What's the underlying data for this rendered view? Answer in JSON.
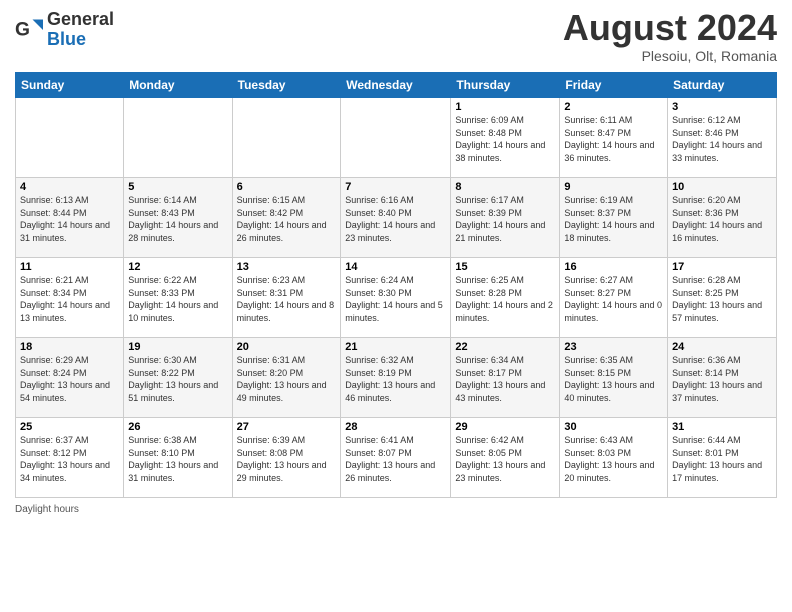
{
  "header": {
    "logo_general": "General",
    "logo_blue": "Blue",
    "month_year": "August 2024",
    "location": "Plesoiu, Olt, Romania"
  },
  "days_of_week": [
    "Sunday",
    "Monday",
    "Tuesday",
    "Wednesday",
    "Thursday",
    "Friday",
    "Saturday"
  ],
  "weeks": [
    [
      {
        "day": "",
        "sunrise": "",
        "sunset": "",
        "daylight": ""
      },
      {
        "day": "",
        "sunrise": "",
        "sunset": "",
        "daylight": ""
      },
      {
        "day": "",
        "sunrise": "",
        "sunset": "",
        "daylight": ""
      },
      {
        "day": "",
        "sunrise": "",
        "sunset": "",
        "daylight": ""
      },
      {
        "day": "1",
        "sunrise": "Sunrise: 6:09 AM",
        "sunset": "Sunset: 8:48 PM",
        "daylight": "Daylight: 14 hours and 38 minutes."
      },
      {
        "day": "2",
        "sunrise": "Sunrise: 6:11 AM",
        "sunset": "Sunset: 8:47 PM",
        "daylight": "Daylight: 14 hours and 36 minutes."
      },
      {
        "day": "3",
        "sunrise": "Sunrise: 6:12 AM",
        "sunset": "Sunset: 8:46 PM",
        "daylight": "Daylight: 14 hours and 33 minutes."
      }
    ],
    [
      {
        "day": "4",
        "sunrise": "Sunrise: 6:13 AM",
        "sunset": "Sunset: 8:44 PM",
        "daylight": "Daylight: 14 hours and 31 minutes."
      },
      {
        "day": "5",
        "sunrise": "Sunrise: 6:14 AM",
        "sunset": "Sunset: 8:43 PM",
        "daylight": "Daylight: 14 hours and 28 minutes."
      },
      {
        "day": "6",
        "sunrise": "Sunrise: 6:15 AM",
        "sunset": "Sunset: 8:42 PM",
        "daylight": "Daylight: 14 hours and 26 minutes."
      },
      {
        "day": "7",
        "sunrise": "Sunrise: 6:16 AM",
        "sunset": "Sunset: 8:40 PM",
        "daylight": "Daylight: 14 hours and 23 minutes."
      },
      {
        "day": "8",
        "sunrise": "Sunrise: 6:17 AM",
        "sunset": "Sunset: 8:39 PM",
        "daylight": "Daylight: 14 hours and 21 minutes."
      },
      {
        "day": "9",
        "sunrise": "Sunrise: 6:19 AM",
        "sunset": "Sunset: 8:37 PM",
        "daylight": "Daylight: 14 hours and 18 minutes."
      },
      {
        "day": "10",
        "sunrise": "Sunrise: 6:20 AM",
        "sunset": "Sunset: 8:36 PM",
        "daylight": "Daylight: 14 hours and 16 minutes."
      }
    ],
    [
      {
        "day": "11",
        "sunrise": "Sunrise: 6:21 AM",
        "sunset": "Sunset: 8:34 PM",
        "daylight": "Daylight: 14 hours and 13 minutes."
      },
      {
        "day": "12",
        "sunrise": "Sunrise: 6:22 AM",
        "sunset": "Sunset: 8:33 PM",
        "daylight": "Daylight: 14 hours and 10 minutes."
      },
      {
        "day": "13",
        "sunrise": "Sunrise: 6:23 AM",
        "sunset": "Sunset: 8:31 PM",
        "daylight": "Daylight: 14 hours and 8 minutes."
      },
      {
        "day": "14",
        "sunrise": "Sunrise: 6:24 AM",
        "sunset": "Sunset: 8:30 PM",
        "daylight": "Daylight: 14 hours and 5 minutes."
      },
      {
        "day": "15",
        "sunrise": "Sunrise: 6:25 AM",
        "sunset": "Sunset: 8:28 PM",
        "daylight": "Daylight: 14 hours and 2 minutes."
      },
      {
        "day": "16",
        "sunrise": "Sunrise: 6:27 AM",
        "sunset": "Sunset: 8:27 PM",
        "daylight": "Daylight: 14 hours and 0 minutes."
      },
      {
        "day": "17",
        "sunrise": "Sunrise: 6:28 AM",
        "sunset": "Sunset: 8:25 PM",
        "daylight": "Daylight: 13 hours and 57 minutes."
      }
    ],
    [
      {
        "day": "18",
        "sunrise": "Sunrise: 6:29 AM",
        "sunset": "Sunset: 8:24 PM",
        "daylight": "Daylight: 13 hours and 54 minutes."
      },
      {
        "day": "19",
        "sunrise": "Sunrise: 6:30 AM",
        "sunset": "Sunset: 8:22 PM",
        "daylight": "Daylight: 13 hours and 51 minutes."
      },
      {
        "day": "20",
        "sunrise": "Sunrise: 6:31 AM",
        "sunset": "Sunset: 8:20 PM",
        "daylight": "Daylight: 13 hours and 49 minutes."
      },
      {
        "day": "21",
        "sunrise": "Sunrise: 6:32 AM",
        "sunset": "Sunset: 8:19 PM",
        "daylight": "Daylight: 13 hours and 46 minutes."
      },
      {
        "day": "22",
        "sunrise": "Sunrise: 6:34 AM",
        "sunset": "Sunset: 8:17 PM",
        "daylight": "Daylight: 13 hours and 43 minutes."
      },
      {
        "day": "23",
        "sunrise": "Sunrise: 6:35 AM",
        "sunset": "Sunset: 8:15 PM",
        "daylight": "Daylight: 13 hours and 40 minutes."
      },
      {
        "day": "24",
        "sunrise": "Sunrise: 6:36 AM",
        "sunset": "Sunset: 8:14 PM",
        "daylight": "Daylight: 13 hours and 37 minutes."
      }
    ],
    [
      {
        "day": "25",
        "sunrise": "Sunrise: 6:37 AM",
        "sunset": "Sunset: 8:12 PM",
        "daylight": "Daylight: 13 hours and 34 minutes."
      },
      {
        "day": "26",
        "sunrise": "Sunrise: 6:38 AM",
        "sunset": "Sunset: 8:10 PM",
        "daylight": "Daylight: 13 hours and 31 minutes."
      },
      {
        "day": "27",
        "sunrise": "Sunrise: 6:39 AM",
        "sunset": "Sunset: 8:08 PM",
        "daylight": "Daylight: 13 hours and 29 minutes."
      },
      {
        "day": "28",
        "sunrise": "Sunrise: 6:41 AM",
        "sunset": "Sunset: 8:07 PM",
        "daylight": "Daylight: 13 hours and 26 minutes."
      },
      {
        "day": "29",
        "sunrise": "Sunrise: 6:42 AM",
        "sunset": "Sunset: 8:05 PM",
        "daylight": "Daylight: 13 hours and 23 minutes."
      },
      {
        "day": "30",
        "sunrise": "Sunrise: 6:43 AM",
        "sunset": "Sunset: 8:03 PM",
        "daylight": "Daylight: 13 hours and 20 minutes."
      },
      {
        "day": "31",
        "sunrise": "Sunrise: 6:44 AM",
        "sunset": "Sunset: 8:01 PM",
        "daylight": "Daylight: 13 hours and 17 minutes."
      }
    ]
  ],
  "footer": {
    "daylight_label": "Daylight hours"
  }
}
